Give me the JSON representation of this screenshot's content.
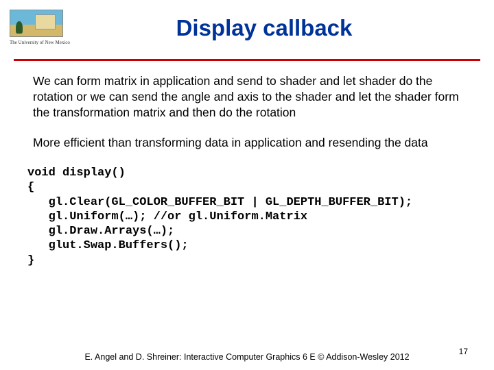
{
  "logo": {
    "university": "The University of New Mexico"
  },
  "title": "Display callback",
  "para1": "We can form matrix in application and send to shader and let shader do the rotation or we can send the angle and axis to the shader and let the shader form the transformation matrix and then do the rotation",
  "para2": "More efficient than transforming data in application and resending the data",
  "code": {
    "line1": "void display()",
    "line2": "{",
    "line3": "   gl.Clear(GL_COLOR_BUFFER_BIT | GL_DEPTH_BUFFER_BIT);",
    "line4": "   gl.Uniform(…); //or gl.Uniform.Matrix",
    "line5": "   gl.Draw.Arrays(…);",
    "line6": "   glut.Swap.Buffers();",
    "line7": "}"
  },
  "footer": "E. Angel and D. Shreiner: Interactive Computer Graphics 6 E © Addison-Wesley 2012",
  "slide_number": "17"
}
